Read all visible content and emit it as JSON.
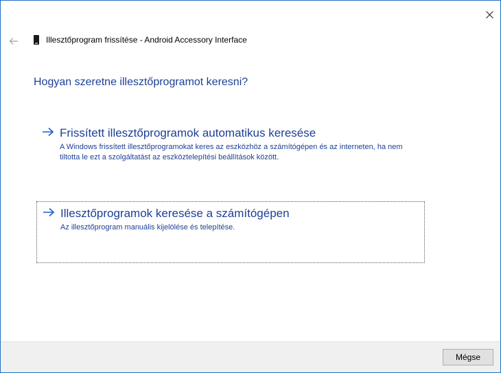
{
  "window": {
    "title": "Illesztőprogram frissítése - Android Accessory Interface"
  },
  "icons": {
    "close": "close-icon",
    "back": "back-arrow-icon",
    "device": "device-icon",
    "option_arrow": "right-arrow-icon"
  },
  "main": {
    "question": "Hogyan szeretne illesztőprogramot keresni?",
    "options": [
      {
        "title": "Frissített illesztőprogramok automatikus keresése",
        "description": "A Windows frissített illesztőprogramokat keres az eszközhöz a számítógépen és az interneten, ha nem tiltotta le ezt a szolgáltatást az eszköztelepítési beállítások között."
      },
      {
        "title": "Illesztőprogramok keresése a számítógépen",
        "description": "Az illesztőprogram manuális kijelölése és telepítése."
      }
    ]
  },
  "footer": {
    "cancel_label": "Mégse"
  },
  "colors": {
    "accent": "#1c3f95",
    "arrow": "#1a5bd6",
    "footer_bg": "#f0f0f0",
    "window_border": "#1e6fbf"
  }
}
